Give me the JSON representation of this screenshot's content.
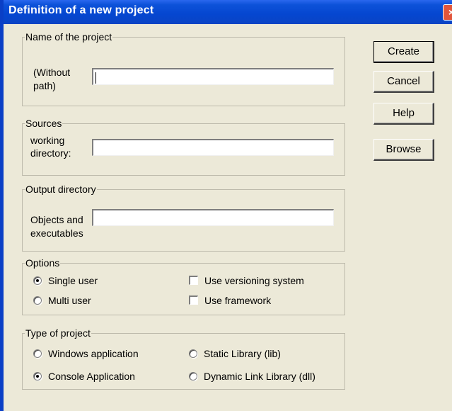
{
  "window": {
    "title": "Definition of a new project",
    "close_glyph": "×"
  },
  "project_name": {
    "legend": "Name of the project",
    "label_line1": "(Without",
    "label_line2": "path)",
    "value": ""
  },
  "sources": {
    "legend": "Sources",
    "label_line1": "working",
    "label_line2": "directory:",
    "value": ""
  },
  "output": {
    "legend": "Output directory",
    "label_line1": "Objects and",
    "label_line2": "executables",
    "value": ""
  },
  "options": {
    "legend": "Options",
    "single_user": {
      "label": "Single user",
      "selected": true
    },
    "multi_user": {
      "label": "Multi user",
      "selected": false
    },
    "use_versioning": {
      "label": "Use versioning system",
      "checked": false
    },
    "use_framework": {
      "label": "Use framework",
      "checked": false
    }
  },
  "project_type": {
    "legend": "Type of project",
    "windows_app": {
      "label": "Windows application",
      "selected": false
    },
    "console_app": {
      "label": "Console Application",
      "selected": true
    },
    "static_lib": {
      "label": "Static Library (lib)",
      "selected": false
    },
    "dynamic_lib": {
      "label": "Dynamic Link Library (dll)",
      "selected": false
    }
  },
  "buttons": {
    "create": "Create",
    "cancel": "Cancel",
    "help": "Help",
    "browse": "Browse"
  },
  "colors": {
    "titlebar": "#0546d0",
    "dialog_bg": "#ece9d8",
    "close_button": "#e2563c"
  }
}
